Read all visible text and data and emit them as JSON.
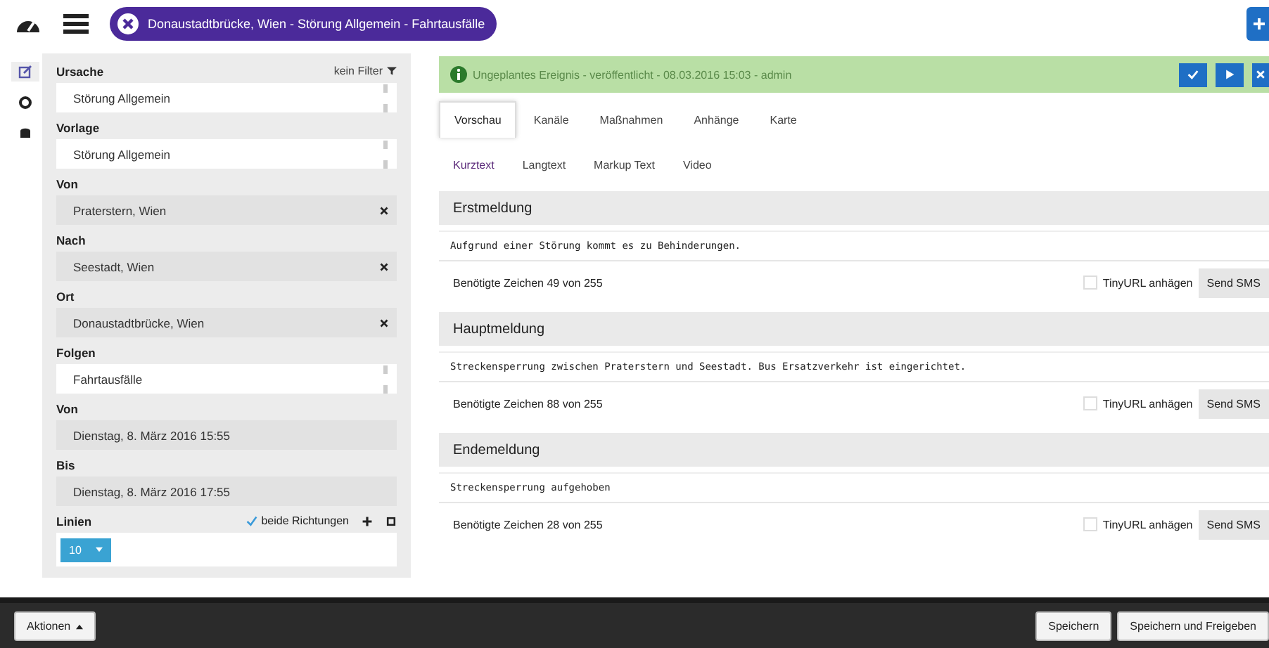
{
  "topbar": {
    "open_tab": "Donaustadtbrücke, Wien - Störung Allgemein - Fahrtausfälle"
  },
  "side_icons": [
    {
      "kind": "edit",
      "selected": true
    },
    {
      "kind": "gear",
      "selected": false
    },
    {
      "kind": "db",
      "selected": false
    }
  ],
  "form": {
    "filter": "kein Filter",
    "fields": [
      {
        "label": "Ursache",
        "value": "Störung Allgemein",
        "kind": "select"
      },
      {
        "label": "Vorlage",
        "value": "Störung Allgemein",
        "kind": "select"
      },
      {
        "label": "Von",
        "value": "Praterstern, Wien",
        "kind": "clearable"
      },
      {
        "label": "Nach",
        "value": "Seestadt, Wien",
        "kind": "clearable"
      },
      {
        "label": "Ort",
        "value": "Donaustadtbrücke, Wien",
        "kind": "clearable"
      },
      {
        "label": "Folgen",
        "value": "Fahrtausfälle",
        "kind": "select"
      },
      {
        "label": "Von",
        "value": "Dienstag, 8. März 2016 15:55",
        "kind": "text"
      },
      {
        "label": "Bis",
        "value": "Dienstag, 8. März 2016 17:55",
        "kind": "text"
      }
    ],
    "lines": {
      "label": "Linien",
      "both_directions": {
        "label": "beide Richtungen",
        "checked": true
      },
      "chips": [
        "10"
      ]
    }
  },
  "status": {
    "text": "Ungeplantes Ereignis - veröffentlicht - 08.03.2016 15:03 - admin"
  },
  "tabs": [
    {
      "label": "Vorschau",
      "selected": true
    },
    {
      "label": "Kanäle",
      "selected": false
    },
    {
      "label": "Maßnahmen",
      "selected": false
    },
    {
      "label": "Anhänge",
      "selected": false
    },
    {
      "label": "Karte",
      "selected": false
    }
  ],
  "subtabs": [
    {
      "label": "Kurztext",
      "selected": true
    },
    {
      "label": "Langtext",
      "selected": false
    },
    {
      "label": "Markup Text",
      "selected": false
    },
    {
      "label": "Video",
      "selected": false
    }
  ],
  "messages": [
    {
      "title": "Erstmeldung",
      "text": "Aufgrund einer Störung kommt es zu Behinderungen.",
      "count": "Benötigte Zeichen 49 von 255",
      "tinyurl": {
        "label": "TinyURL anhägen",
        "checked": false
      },
      "send": "Send SMS"
    },
    {
      "title": "Hauptmeldung",
      "text": "Streckensperrung zwischen Praterstern und Seestadt. Bus Ersatzverkehr ist eingerichtet.",
      "count": "Benötigte Zeichen 88 von 255",
      "tinyurl": {
        "label": "TinyURL anhägen",
        "checked": false
      },
      "send": "Send SMS"
    },
    {
      "title": "Endemeldung",
      "text": "Streckensperrung aufgehoben",
      "count": "Benötigte Zeichen 28 von 255",
      "tinyurl": {
        "label": "TinyURL anhägen",
        "checked": false
      },
      "send": "Send SMS"
    }
  ],
  "footer": {
    "actions": "Aktionen",
    "buttons": [
      "Speichern",
      "Speichern und Freigeben"
    ]
  }
}
